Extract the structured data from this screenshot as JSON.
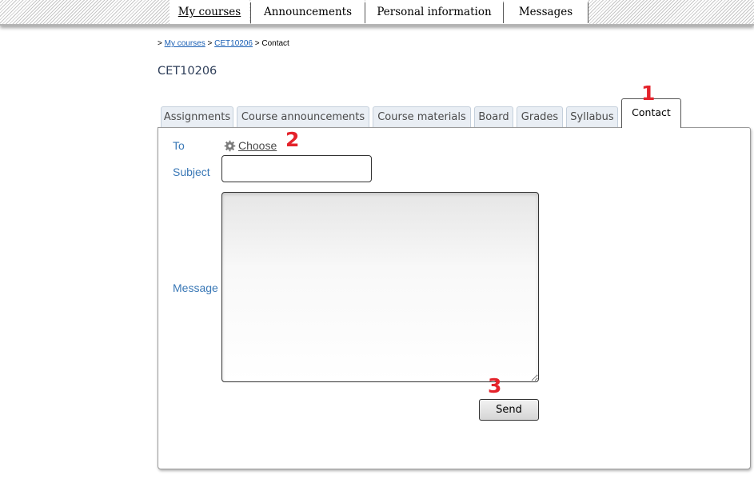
{
  "topnav": {
    "items": [
      {
        "label": "My courses",
        "active": true
      },
      {
        "label": "Announcements",
        "active": false
      },
      {
        "label": "Personal information",
        "active": false
      },
      {
        "label": "Messages",
        "active": false
      }
    ]
  },
  "breadcrumb": {
    "prefix": ">",
    "items": [
      "My courses",
      "CET10206",
      "Contact"
    ],
    "separator": ">"
  },
  "course": {
    "title": "CET10206"
  },
  "tabs": [
    {
      "label": "Assignments"
    },
    {
      "label": "Course announcements"
    },
    {
      "label": "Course materials"
    },
    {
      "label": "Board"
    },
    {
      "label": "Grades"
    },
    {
      "label": "Syllabus"
    },
    {
      "label": "Contact",
      "active": true
    }
  ],
  "form": {
    "to_label": "To",
    "choose_label": "Choose",
    "choose_icon": "gear-icon",
    "subject_label": "Subject",
    "subject_value": "",
    "message_label": "Message",
    "message_value": "",
    "send_label": "Send"
  },
  "annotations": {
    "marker_1": "1",
    "marker_2": "2",
    "marker_3": "3",
    "color": "#e4232b"
  },
  "colors": {
    "label_blue": "#3a78b6",
    "link_blue": "#1a5fb4",
    "title_navy": "#2e3e59"
  }
}
